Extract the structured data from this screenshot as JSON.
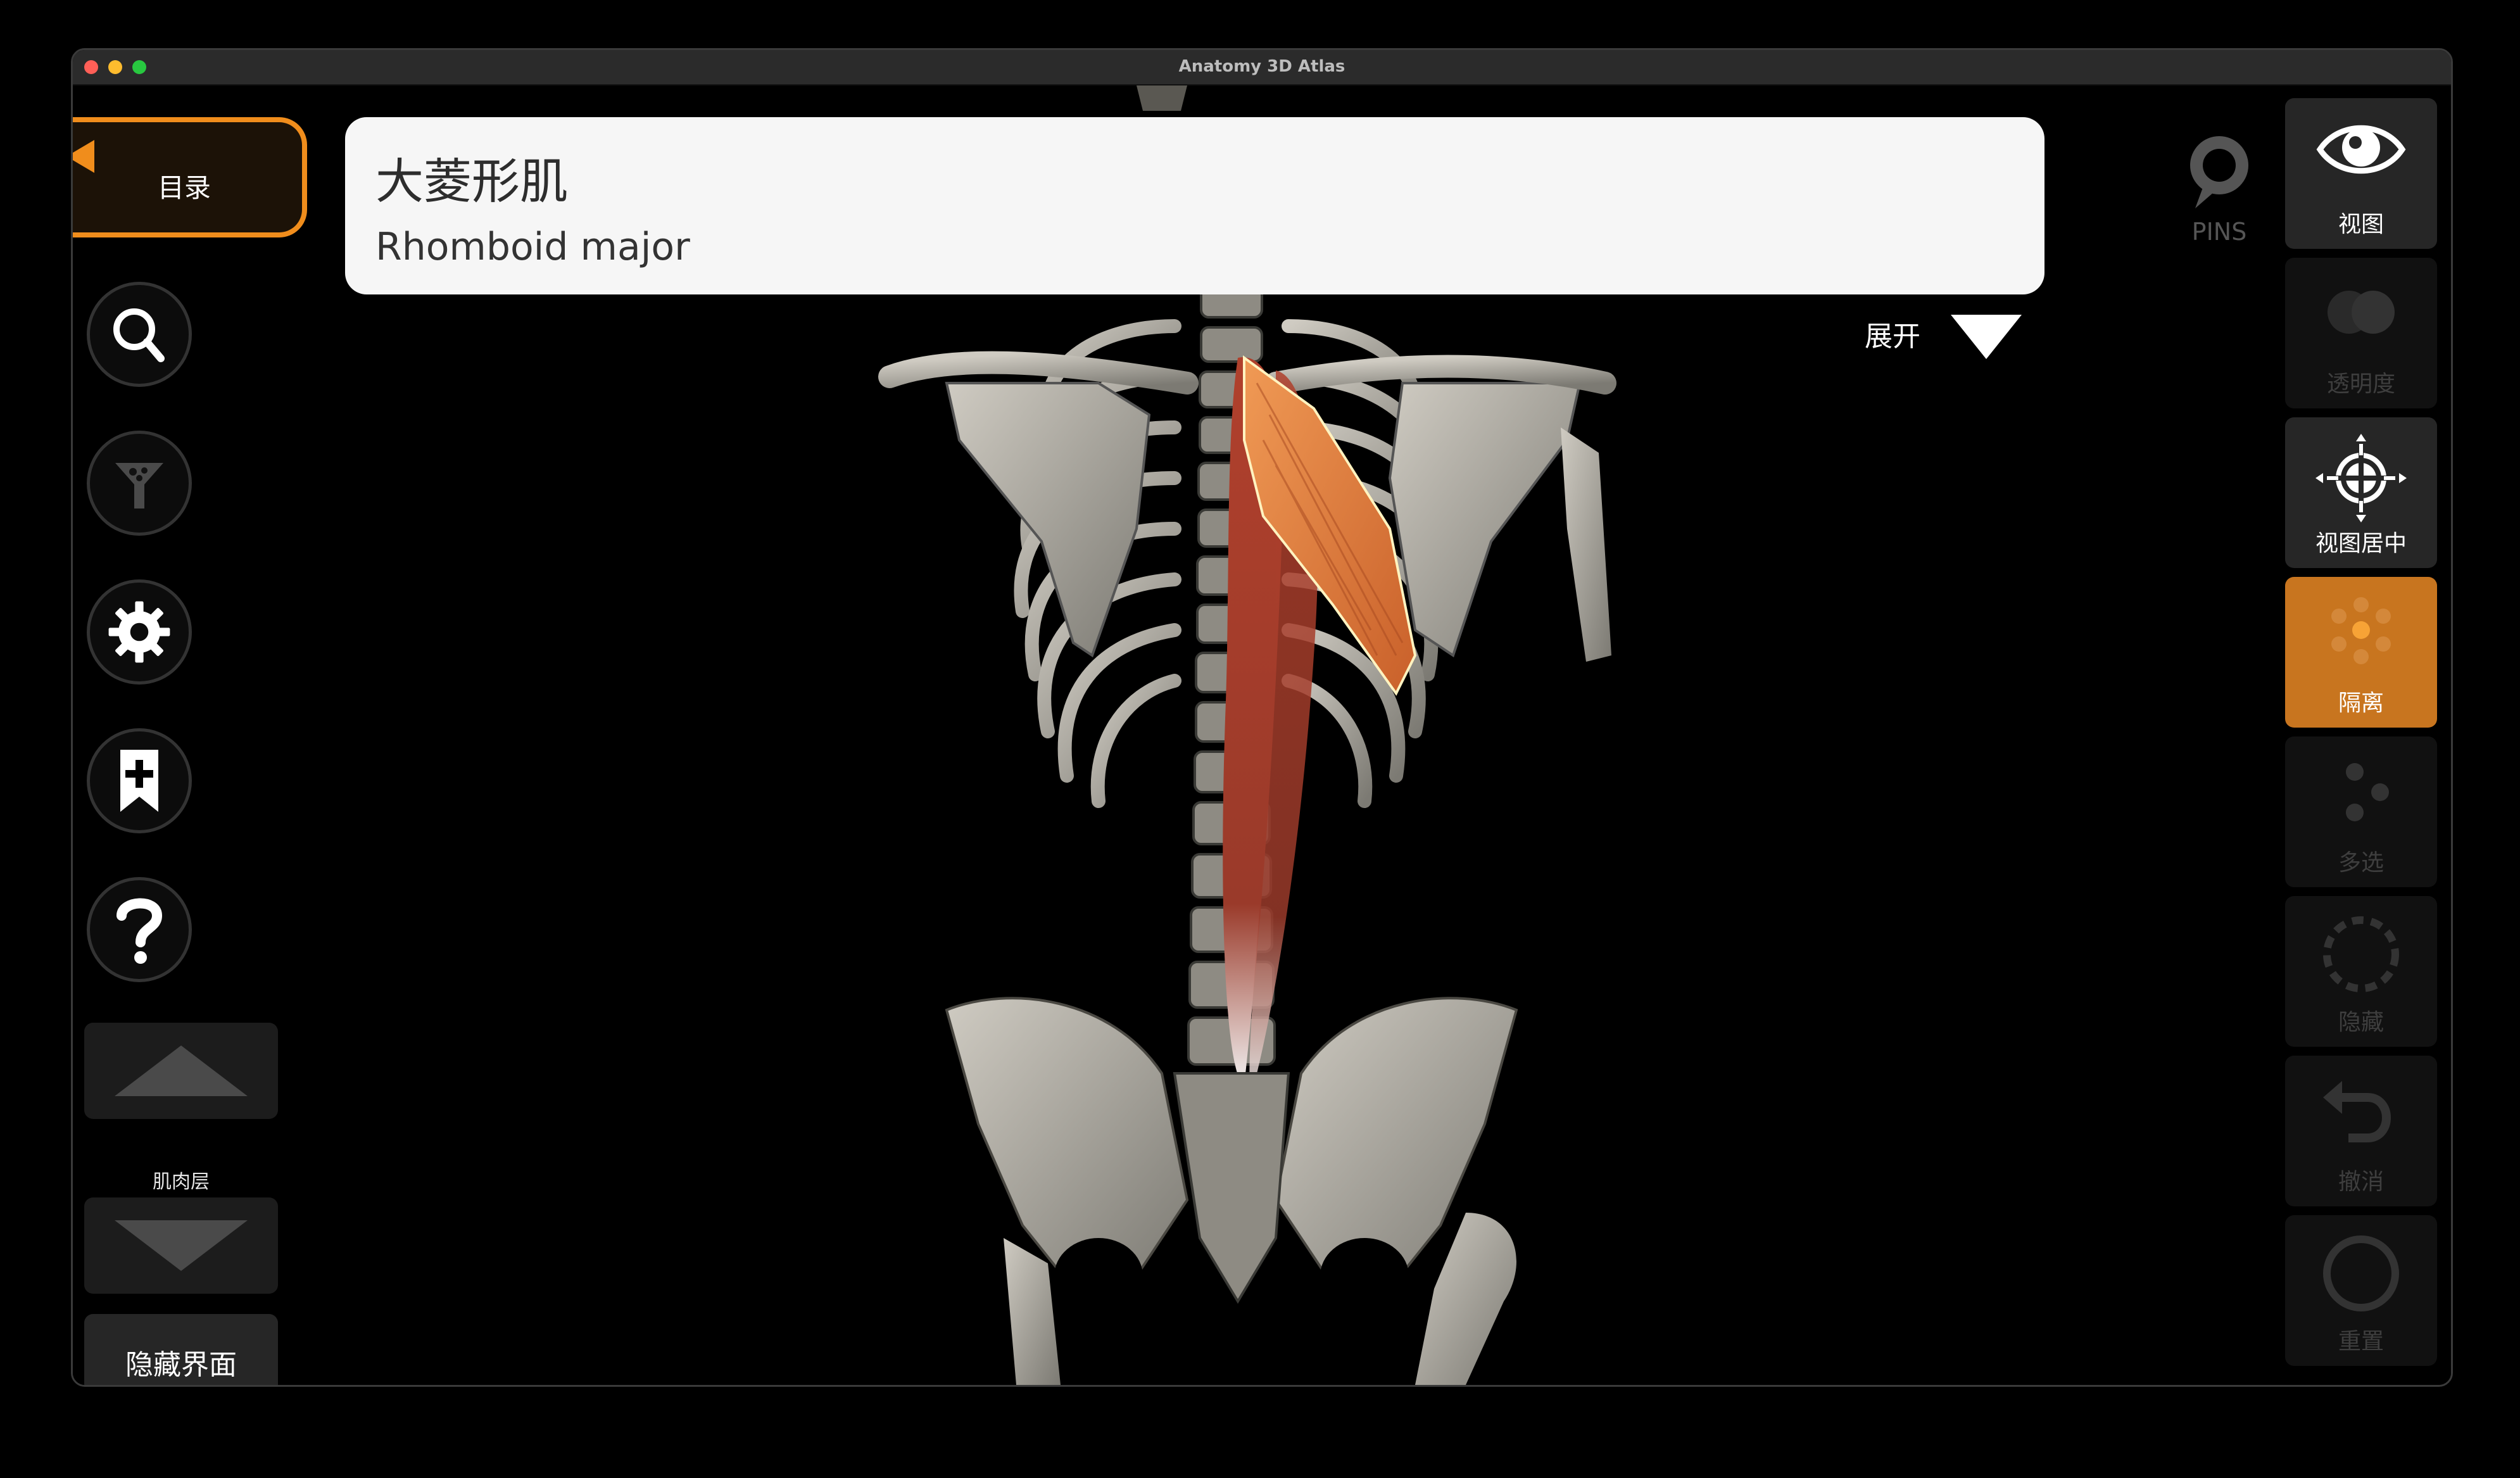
{
  "window": {
    "title": "Anatomy 3D Atlas"
  },
  "toc": {
    "label": "目录"
  },
  "header": {
    "name_cn": "大菱形肌",
    "name_en": "Rhomboid major",
    "expand_label": "展开"
  },
  "pins": {
    "label": "PINS"
  },
  "left_tools": {
    "search_icon": "search-icon",
    "filter_icon": "filter-icon",
    "settings_icon": "gear-icon",
    "bookmark_icon": "bookmark-add-icon",
    "help_icon": "question-icon",
    "layer_label": "肌肉层",
    "hide_ui_label": "隐藏界面"
  },
  "right_panel": [
    {
      "label": "视图",
      "icon": "eye-icon",
      "state": "enabled"
    },
    {
      "label": "透明度",
      "icon": "transparency-icon",
      "state": "disabled"
    },
    {
      "label": "视图居中",
      "icon": "crosshair-icon",
      "state": "enabled"
    },
    {
      "label": "隔离",
      "icon": "isolate-icon",
      "state": "active"
    },
    {
      "label": "多选",
      "icon": "multiselect-icon",
      "state": "disabled"
    },
    {
      "label": "隐藏",
      "icon": "hide-icon",
      "state": "disabled"
    },
    {
      "label": "撤消",
      "icon": "undo-icon",
      "state": "disabled"
    },
    {
      "label": "重置",
      "icon": "reset-icon",
      "state": "disabled"
    }
  ],
  "colors": {
    "accent": "#f08d1c",
    "active": "#c8751f",
    "muscle": "#e07a3e"
  }
}
